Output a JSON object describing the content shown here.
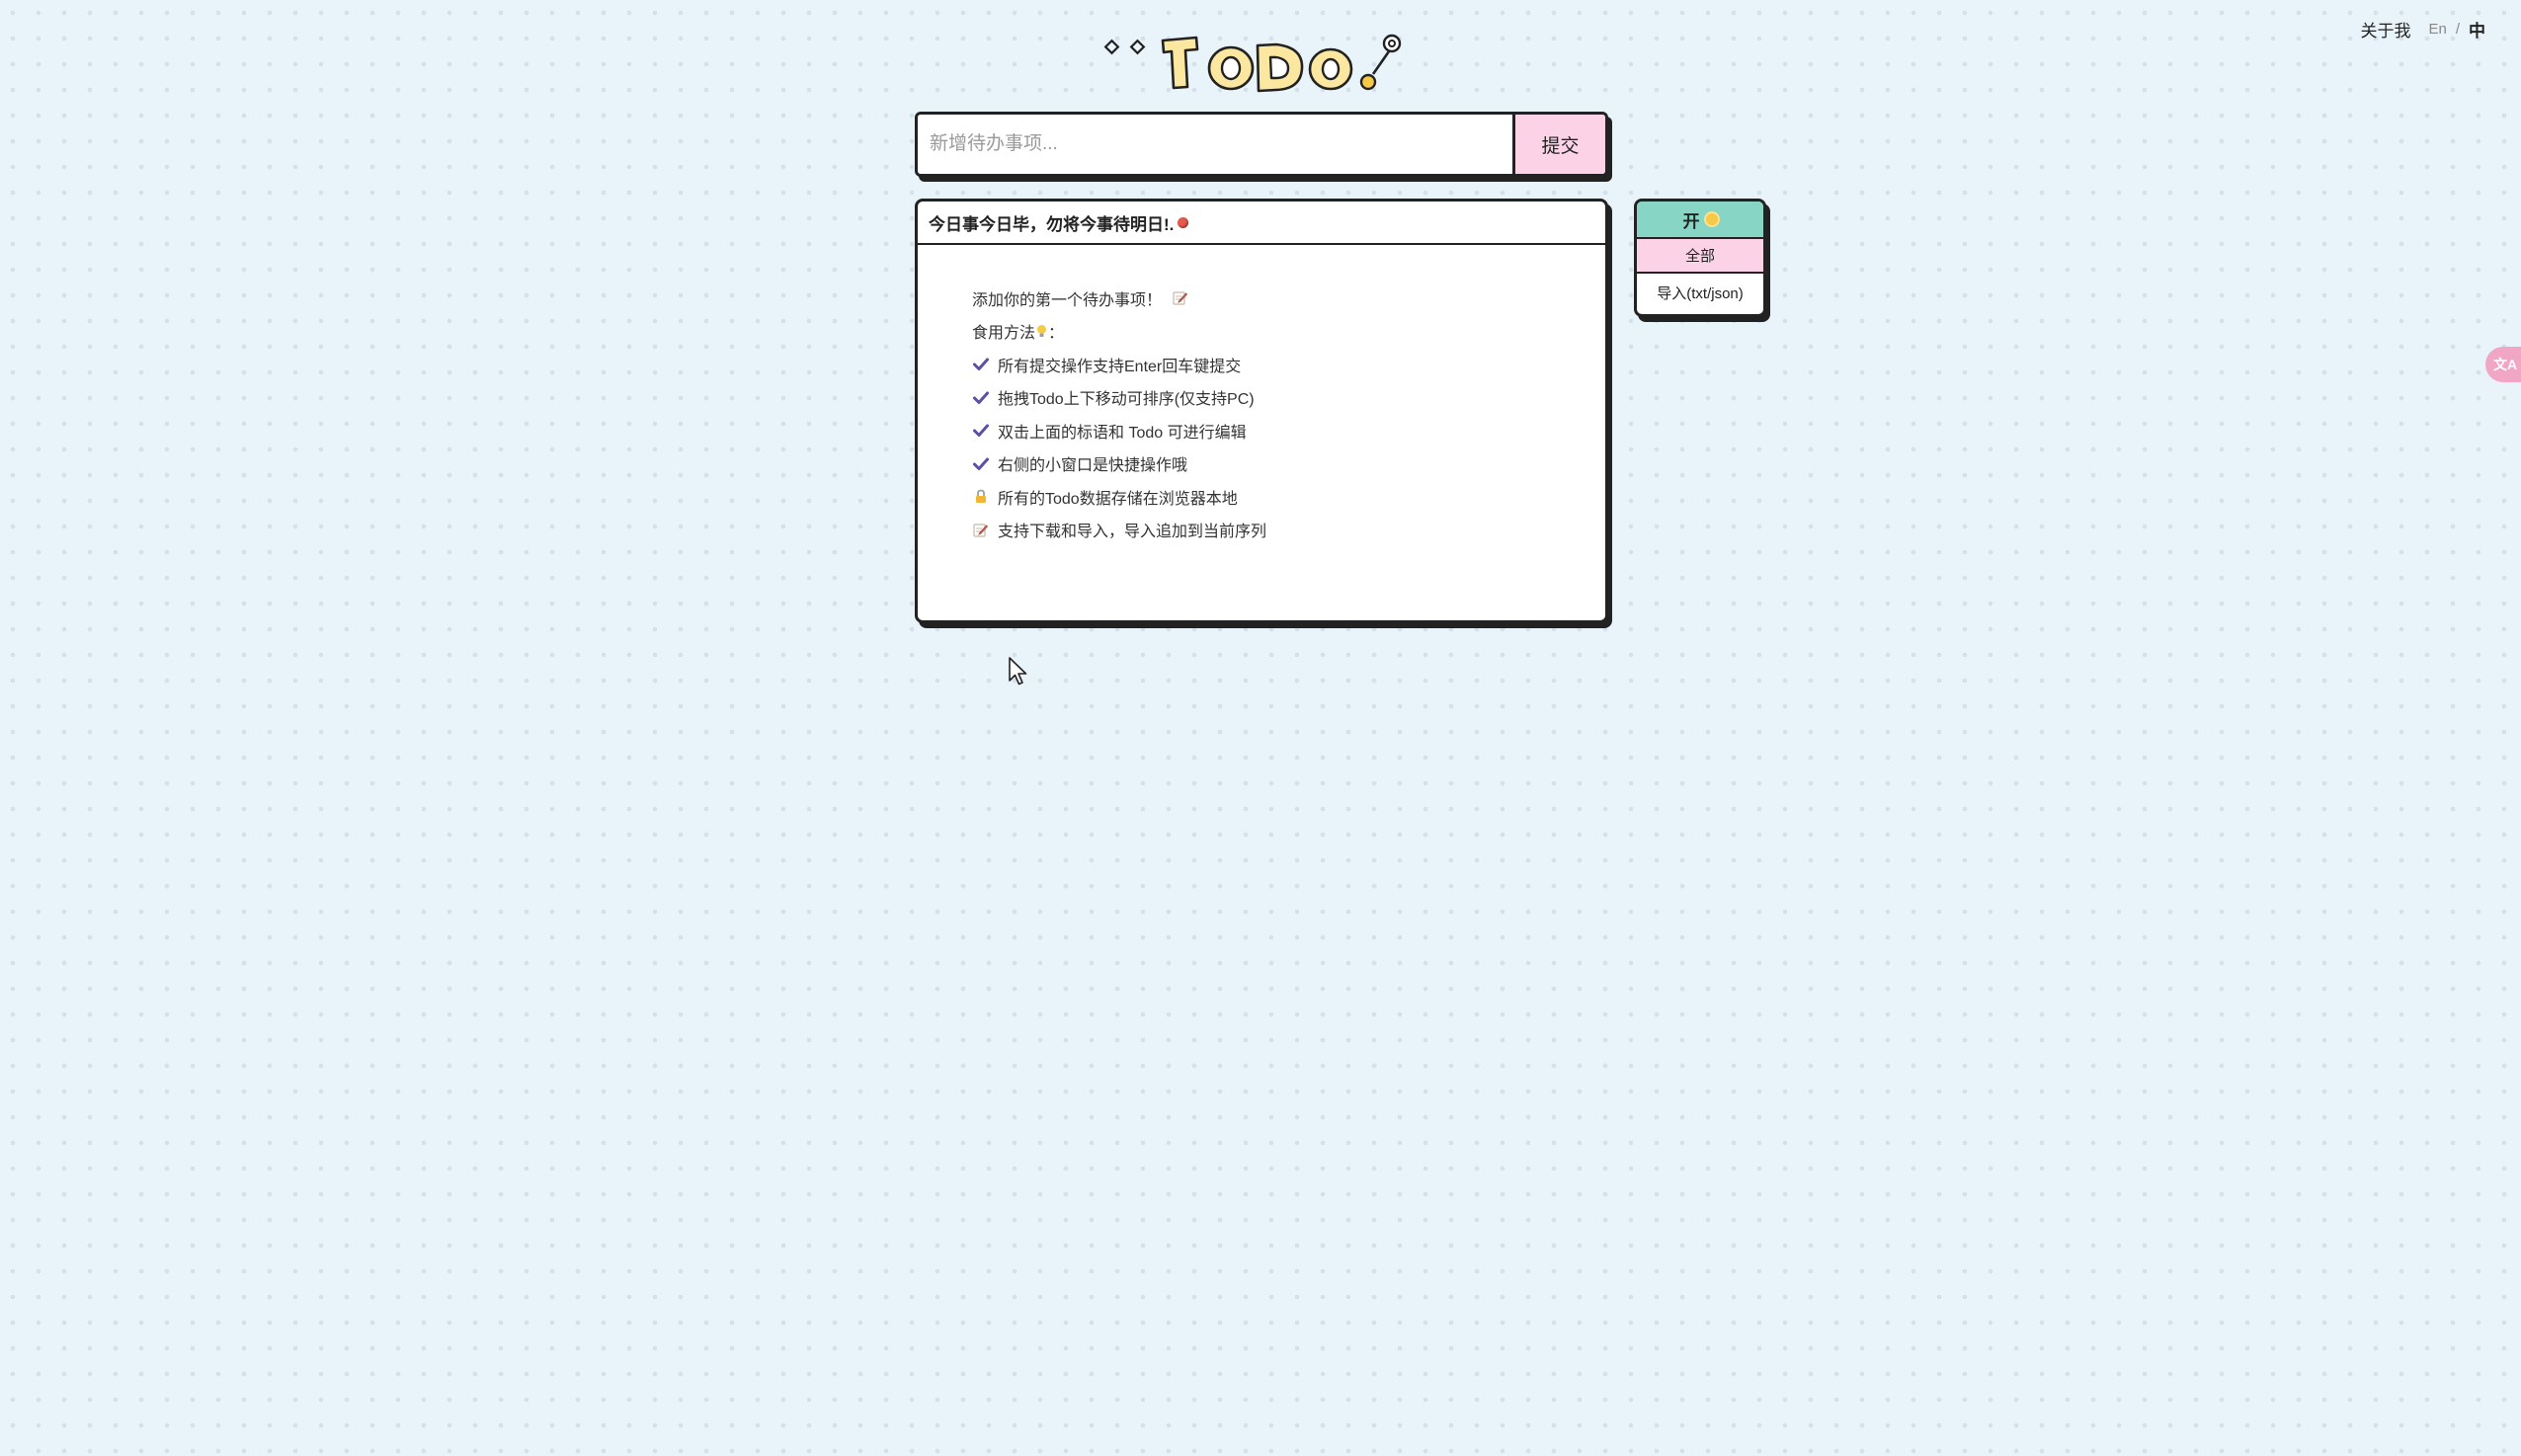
{
  "nav": {
    "about": "关于我",
    "lang_en": "En",
    "lang_sep": "/",
    "lang_zh": "中"
  },
  "logo": {
    "text": "TODO"
  },
  "input": {
    "placeholder": "新增待办事项...",
    "value": "",
    "submit_label": "提交"
  },
  "card": {
    "title": "今日事今日毕，勿将今事待明日!.",
    "intro": "添加你的第一个待办事项！",
    "usage_label": "食用方法",
    "usage_suffix": "：",
    "tips": [
      {
        "icon": "check-icon",
        "text": "所有提交操作支持Enter回车键提交"
      },
      {
        "icon": "check-icon",
        "text": "拖拽Todo上下移动可排序(仅支持PC)"
      },
      {
        "icon": "check-icon",
        "text": "双击上面的标语和 Todo 可进行编辑"
      },
      {
        "icon": "check-icon",
        "text": "右侧的小窗口是快捷操作哦"
      },
      {
        "icon": "lock-icon",
        "text": "所有的Todo数据存储在浏览器本地"
      },
      {
        "icon": "memo-icon",
        "text": "支持下载和导入，导入追加到当前序列"
      }
    ]
  },
  "side_panel": {
    "toggle_label": "开",
    "filter_all": "全部",
    "import_label": "导入(txt/json)"
  },
  "translate_float": {
    "label": "文A"
  },
  "colors": {
    "background": "#e9f3fa",
    "accent_pink": "#fcd3e6",
    "accent_teal": "#87d5c5",
    "check_purple": "#5b4fa8",
    "border": "#222222"
  }
}
